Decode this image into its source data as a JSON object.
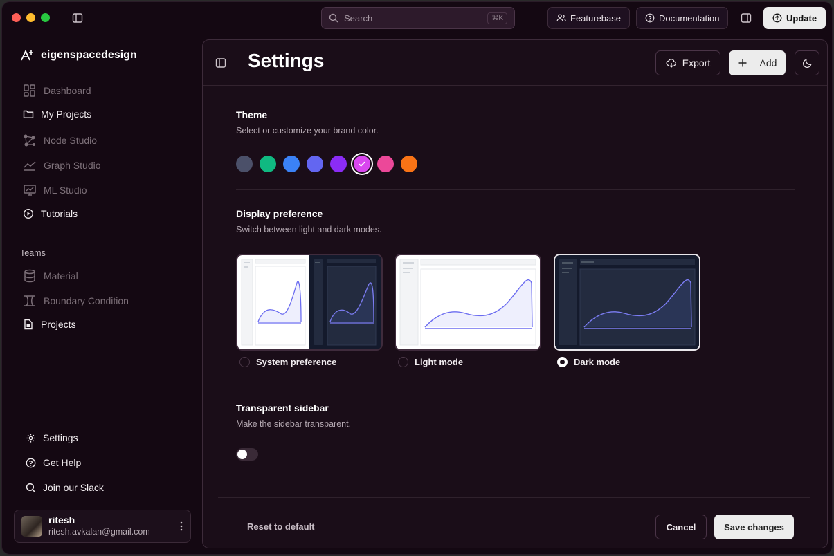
{
  "titlebar": {
    "search_placeholder": "Search",
    "search_shortcut": "⌘K",
    "featurebase_label": "Featurebase",
    "documentation_label": "Documentation",
    "update_label": "Update"
  },
  "sidebar": {
    "brand": "eigenspacedesign",
    "items": [
      {
        "label": "Dashboard",
        "icon": "dashboard-icon",
        "enabled": false
      },
      {
        "label": "My Projects",
        "icon": "folder-icon",
        "enabled": true
      },
      {
        "label": "Node Studio",
        "icon": "nodes-icon",
        "enabled": false
      },
      {
        "label": "Graph Studio",
        "icon": "chart-line-icon",
        "enabled": false
      },
      {
        "label": "ML Studio",
        "icon": "monitor-icon",
        "enabled": false
      },
      {
        "label": "Tutorials",
        "icon": "play-circle-icon",
        "enabled": true
      }
    ],
    "teams_label": "Teams",
    "team_items": [
      {
        "label": "Material",
        "icon": "database-icon",
        "enabled": false
      },
      {
        "label": "Boundary Condition",
        "icon": "boundary-icon",
        "enabled": false
      },
      {
        "label": "Projects",
        "icon": "file-icon",
        "enabled": true
      }
    ],
    "bottom_items": [
      {
        "label": "Settings",
        "icon": "gear-icon"
      },
      {
        "label": "Get Help",
        "icon": "help-icon"
      },
      {
        "label": "Join our Slack",
        "icon": "search-icon"
      }
    ],
    "user": {
      "name": "ritesh",
      "email": "ritesh.avkalan@gmail.com"
    }
  },
  "main": {
    "title": "Settings",
    "export_label": "Export",
    "add_label": "Add",
    "theme": {
      "title": "Theme",
      "description": "Select or customize your brand color.",
      "colors": [
        "#4b5069",
        "#10b981",
        "#3b82f6",
        "#6366f1",
        "#8b2cf5",
        "#d946ef",
        "#ec4899",
        "#f97316"
      ],
      "selected_index": 5
    },
    "display": {
      "title": "Display preference",
      "description": "Switch between light and dark modes.",
      "options": [
        {
          "label": "System preference",
          "selected": false
        },
        {
          "label": "Light mode",
          "selected": false
        },
        {
          "label": "Dark mode",
          "selected": true
        }
      ]
    },
    "transparent": {
      "title": "Transparent sidebar",
      "description": "Make the sidebar transparent.",
      "enabled": false
    },
    "footer": {
      "reset_label": "Reset to default",
      "cancel_label": "Cancel",
      "save_label": "Save changes"
    }
  }
}
